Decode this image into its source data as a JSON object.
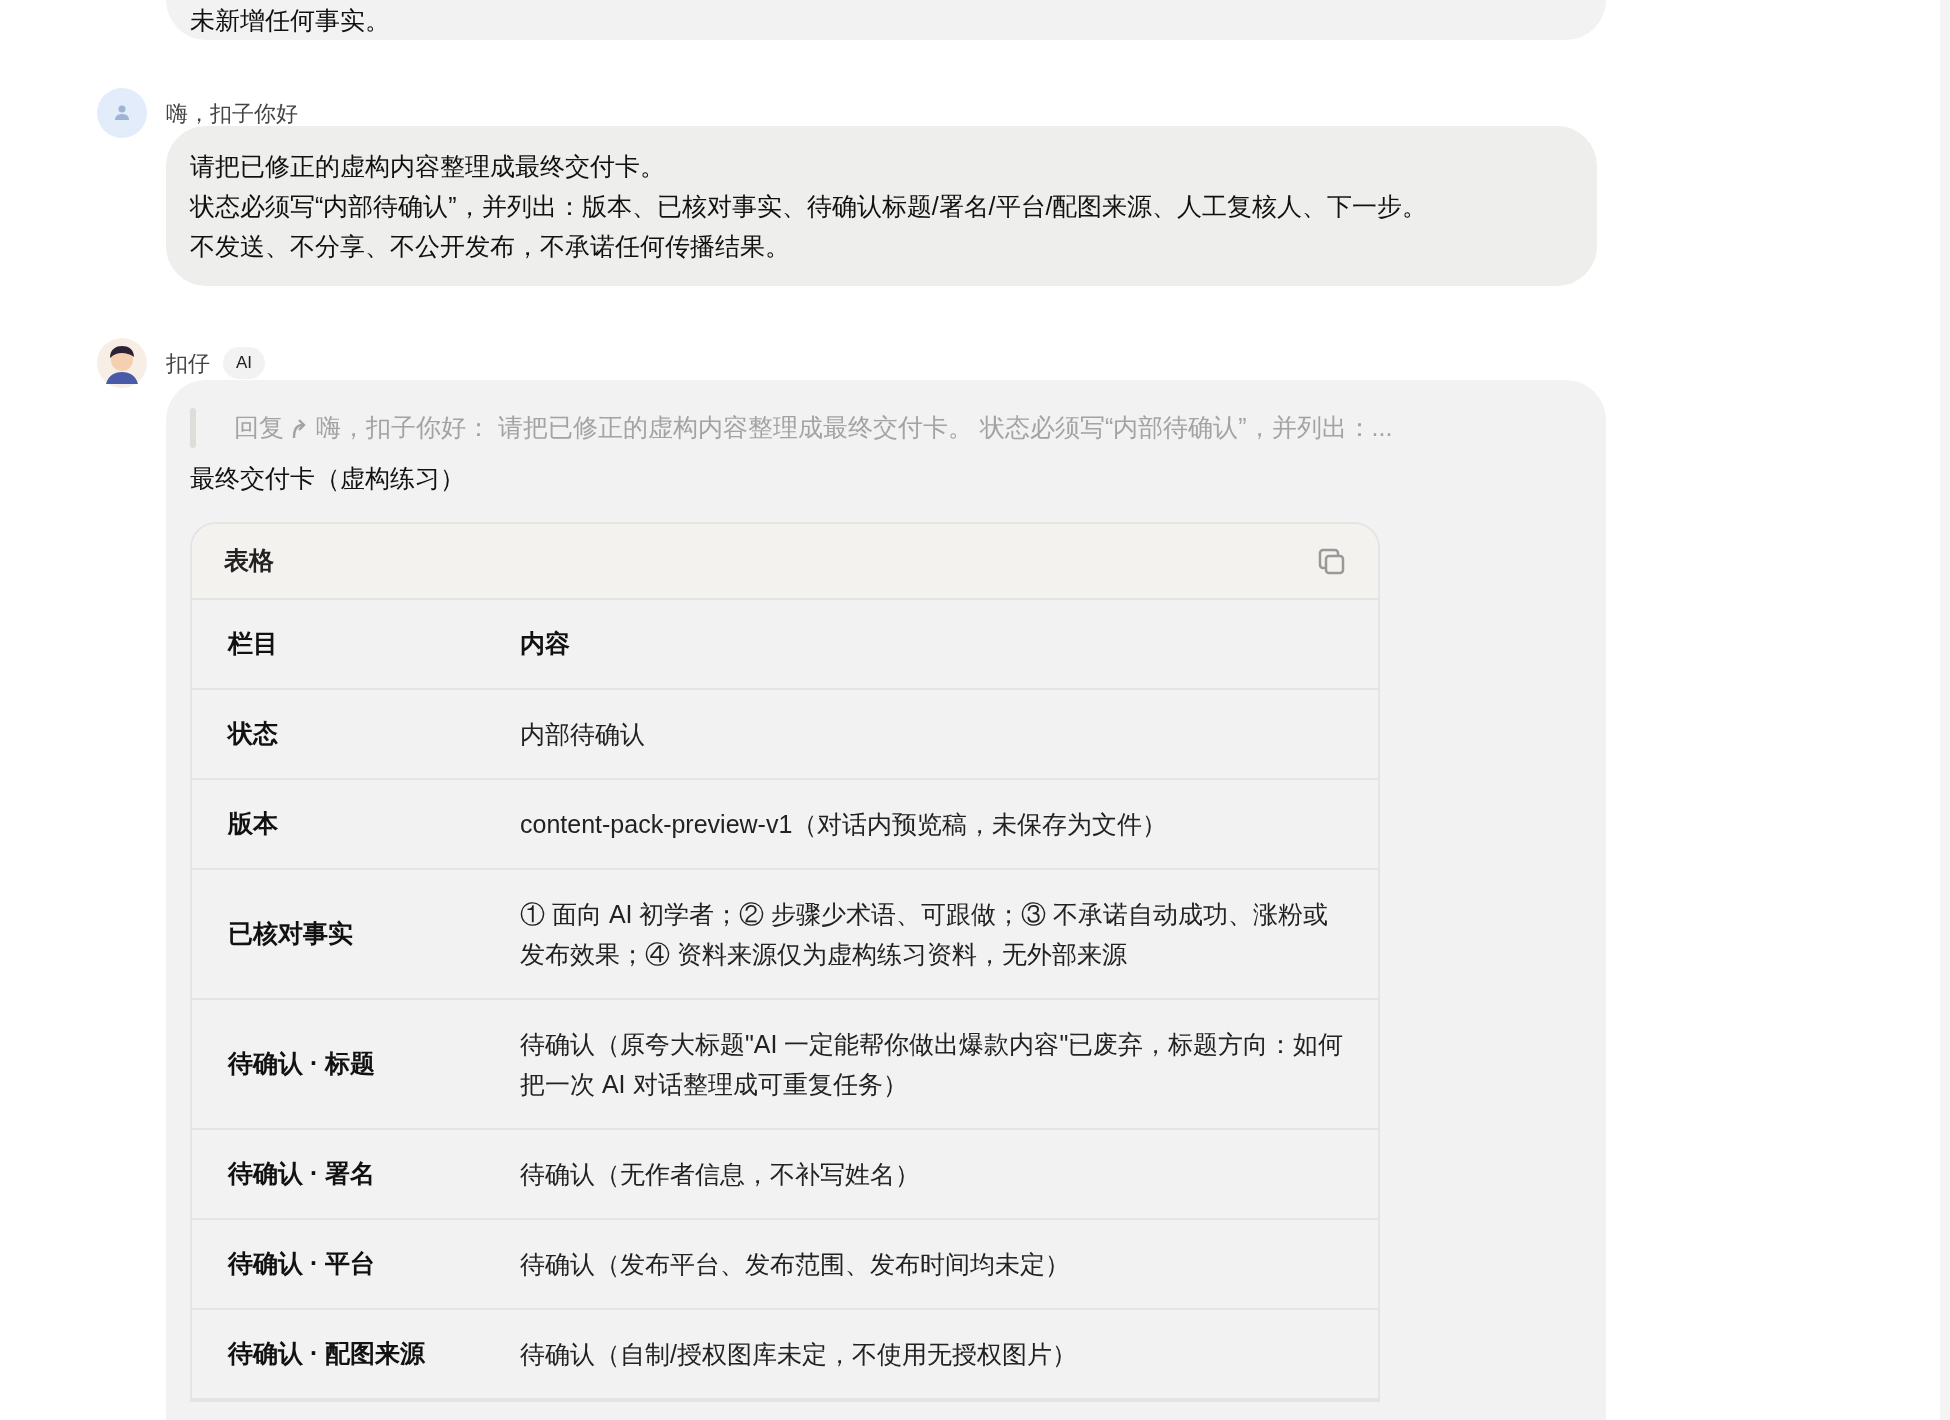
{
  "messages": [
    {
      "kind": "partial",
      "paragraphs": [
        "未新增任何事实。"
      ]
    },
    {
      "kind": "user",
      "sender": "嗨，扣子你好",
      "paragraphs": [
        "请把已修正的虚构内容整理成最终交付卡。",
        "状态必须写“内部待确认”，并列出：版本、已核对事实、待确认标题/署名/平台/配图来源、人工复核人、下一步。",
        "不发送、不分享、不公开发布，不承诺任何传播结果。"
      ]
    },
    {
      "kind": "ai",
      "sender": "扣仔",
      "badge": "AI",
      "quote": {
        "label": "回复",
        "text": "嗨，扣子你好：  请把已修正的虚构内容整理成最终交付卡。 状态必须写“内部待确认”，并列出：..."
      },
      "title": "最终交付卡（虚构练习）",
      "table": {
        "title": "表格",
        "columns": [
          "栏目",
          "内容"
        ],
        "rows": [
          [
            "状态",
            "内部待确认"
          ],
          [
            "版本",
            "content-pack-preview-v1（对话内预览稿，未保存为文件）"
          ],
          [
            "已核对事实",
            "① 面向 AI 初学者；② 步骤少术语、可跟做；③ 不承诺自动成功、涨粉或发布效果；④ 资料来源仅为虚构练习资料，无外部来源"
          ],
          [
            "待确认 · 标题",
            "待确认（原夸大标题\"AI 一定能帮你做出爆款内容\"已废弃，标题方向：如何把一次 AI 对话整理成可重复任务）"
          ],
          [
            "待确认 · 署名",
            "待确认（无作者信息，不补写姓名）"
          ],
          [
            "待确认 · 平台",
            "待确认（发布平台、发布范围、发布时间均未定）"
          ],
          [
            "待确认 · 配图来源",
            "待确认（自制/授权图库未定，不使用无授权图片）"
          ]
        ]
      }
    }
  ]
}
